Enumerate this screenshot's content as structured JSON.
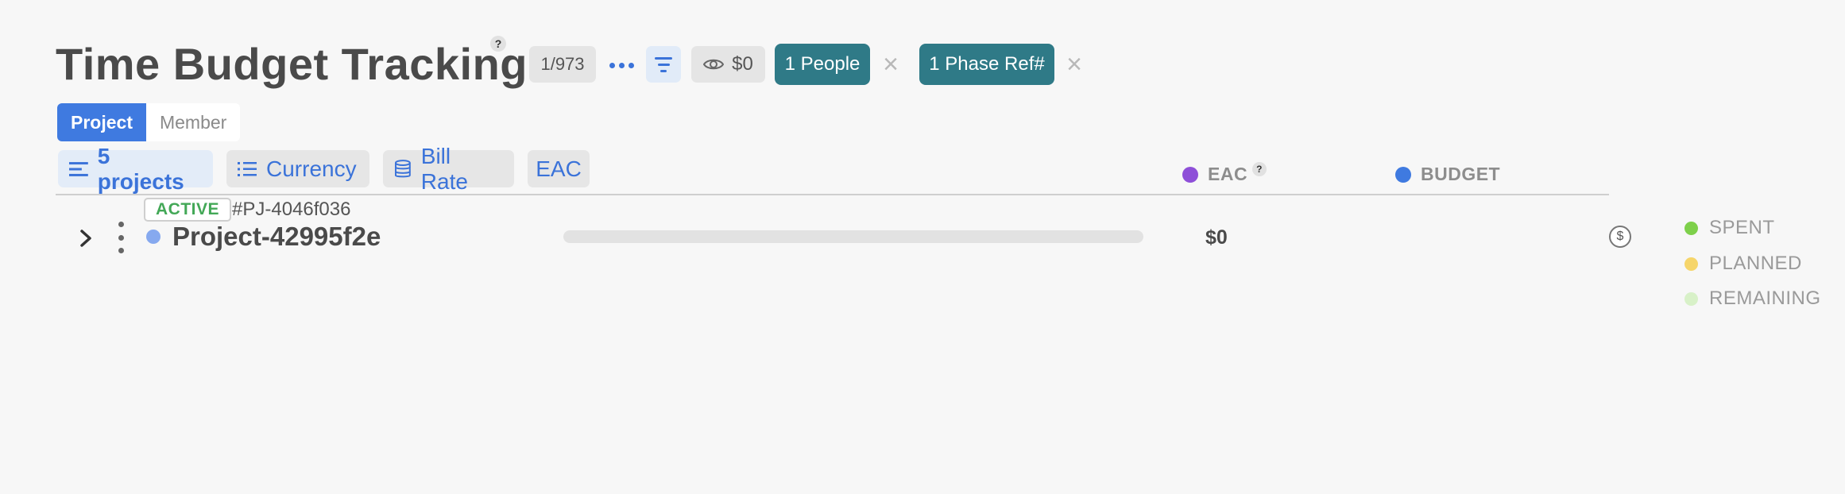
{
  "header": {
    "title": "Time Budget Tracking",
    "help": "?",
    "counter": "1/973",
    "view_value": "$0",
    "filters": [
      {
        "label": "1 People",
        "remove": "×"
      },
      {
        "label": "1 Phase Ref#",
        "remove": "×"
      }
    ]
  },
  "view_toggle": {
    "options": [
      "Project",
      "Member"
    ],
    "selected": "Project"
  },
  "columns_bar": {
    "projects": "5 projects",
    "currency": "Currency",
    "bill_rate": "Bill Rate",
    "eac": "EAC"
  },
  "column_headers": {
    "eac": {
      "label": "EAC",
      "help": "?",
      "color": "#8e4fd8"
    },
    "budget": {
      "label": "BUDGET",
      "color": "#3f7ae0"
    }
  },
  "row": {
    "status": "ACTIVE",
    "ref": "#PJ-4046f036",
    "name": "Project-42995f2e",
    "eac_value": "$0",
    "currency_symbol": "$"
  },
  "legend": [
    {
      "label": "SPENT",
      "color": "#7ed04b"
    },
    {
      "label": "PLANNED",
      "color": "#f6d56a"
    },
    {
      "label": "REMAINING",
      "color": "#d8f1c8"
    }
  ],
  "colors": {
    "accent": "#3f7ae0",
    "filter_chip": "#2f7a87",
    "status_active": "#43a857"
  }
}
